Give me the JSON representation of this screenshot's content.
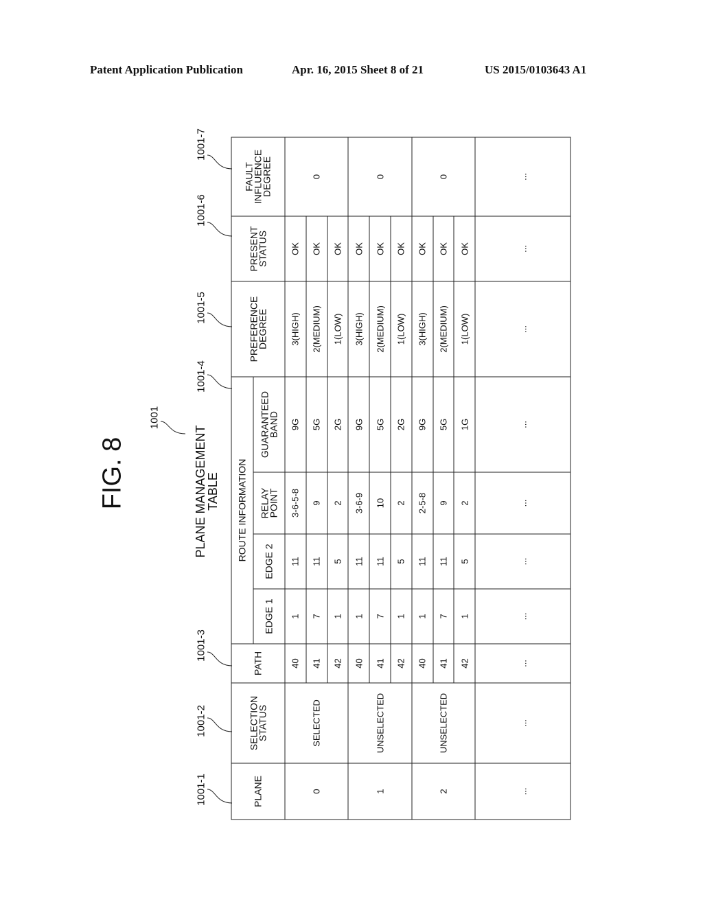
{
  "header": {
    "publication": "Patent Application Publication",
    "date_sheet": "Apr. 16, 2015  Sheet 8 of 21",
    "number": "US 2015/0103643 A1"
  },
  "figure": {
    "label": "FIG. 8",
    "table_title_line1": "PLANE  MANAGEMENT",
    "table_title_line2": "TABLE",
    "table_ref": "1001"
  },
  "column_refs": [
    "1001-1",
    "1001-2",
    "1001-3",
    "1001-4",
    "1001-5",
    "1001-6",
    "1001-7"
  ],
  "columns": {
    "plane": "PLANE",
    "selection_status_1": "SELECTION",
    "selection_status_2": "STATUS",
    "path": "PATH",
    "route_information": "ROUTE  INFORMATION",
    "edge1": "EDGE 1",
    "edge2": "EDGE 2",
    "relay_point_1": "RELAY",
    "relay_point_2": "POINT",
    "guaranteed_band_1": "GUARANTEED",
    "guaranteed_band_2": "BAND",
    "preference_degree_1": "PREFERENCE",
    "preference_degree_2": "DEGREE",
    "present_status_1": "PRESENT",
    "present_status_2": "STATUS",
    "fault_influence_1": "FAULT",
    "fault_influence_2": "INFLUENCE",
    "fault_influence_3": "DEGREE"
  },
  "planes": [
    {
      "plane": "0",
      "selection_status": "SELECTED",
      "fault_influence_degree": "0",
      "paths": [
        {
          "path": "40",
          "edge1": "1",
          "edge2": "11",
          "relay_point": "3-6-5-8",
          "guaranteed_band": "9G",
          "preference_degree": "3(HIGH)",
          "present_status": "OK"
        },
        {
          "path": "41",
          "edge1": "7",
          "edge2": "11",
          "relay_point": "9",
          "guaranteed_band": "5G",
          "preference_degree": "2(MEDIUM)",
          "present_status": "OK"
        },
        {
          "path": "42",
          "edge1": "1",
          "edge2": "5",
          "relay_point": "2",
          "guaranteed_band": "2G",
          "preference_degree": "1(LOW)",
          "present_status": "OK"
        }
      ]
    },
    {
      "plane": "1",
      "selection_status": "UNSELECTED",
      "fault_influence_degree": "0",
      "paths": [
        {
          "path": "40",
          "edge1": "1",
          "edge2": "11",
          "relay_point": "3-6-9",
          "guaranteed_band": "9G",
          "preference_degree": "3(HIGH)",
          "present_status": "OK"
        },
        {
          "path": "41",
          "edge1": "7",
          "edge2": "11",
          "relay_point": "10",
          "guaranteed_band": "5G",
          "preference_degree": "2(MEDIUM)",
          "present_status": "OK"
        },
        {
          "path": "42",
          "edge1": "1",
          "edge2": "5",
          "relay_point": "2",
          "guaranteed_band": "2G",
          "preference_degree": "1(LOW)",
          "present_status": "OK"
        }
      ]
    },
    {
      "plane": "2",
      "selection_status": "UNSELECTED",
      "fault_influence_degree": "0",
      "paths": [
        {
          "path": "40",
          "edge1": "1",
          "edge2": "11",
          "relay_point": "2-5-8",
          "guaranteed_band": "9G",
          "preference_degree": "3(HIGH)",
          "present_status": "OK"
        },
        {
          "path": "41",
          "edge1": "7",
          "edge2": "11",
          "relay_point": "9",
          "guaranteed_band": "5G",
          "preference_degree": "2(MEDIUM)",
          "present_status": "OK"
        },
        {
          "path": "42",
          "edge1": "1",
          "edge2": "5",
          "relay_point": "2",
          "guaranteed_band": "1G",
          "preference_degree": "1(LOW)",
          "present_status": "OK"
        }
      ]
    }
  ],
  "ellipsis": "..."
}
